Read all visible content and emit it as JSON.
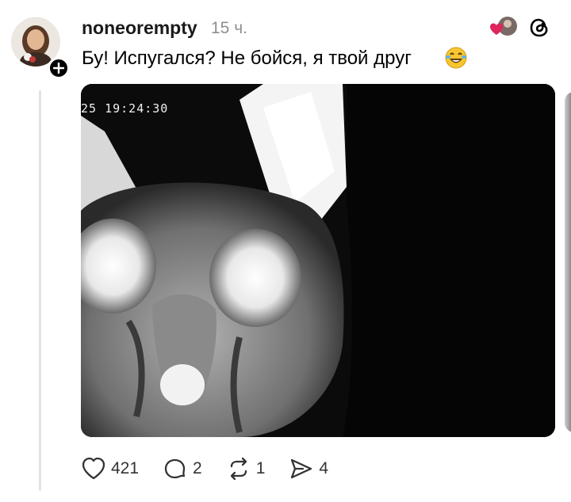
{
  "post": {
    "username": "noneorempty",
    "time": "15 ч.",
    "text": "Бу! Испугался? Не бойся, я твой друг",
    "video_overlay": "25 19:24:30"
  },
  "actions": {
    "likes": "421",
    "replies": "2",
    "reposts": "1",
    "shares": "4"
  },
  "icons": {
    "like": "heart-icon",
    "reply": "comment-icon",
    "repost": "repost-icon",
    "share": "send-icon",
    "app": "threads-logo-icon",
    "emoji": "laughing-tears-emoji"
  },
  "colors": {
    "heart_accent": "#e0245e",
    "timestamp": "#8e8e8e"
  }
}
